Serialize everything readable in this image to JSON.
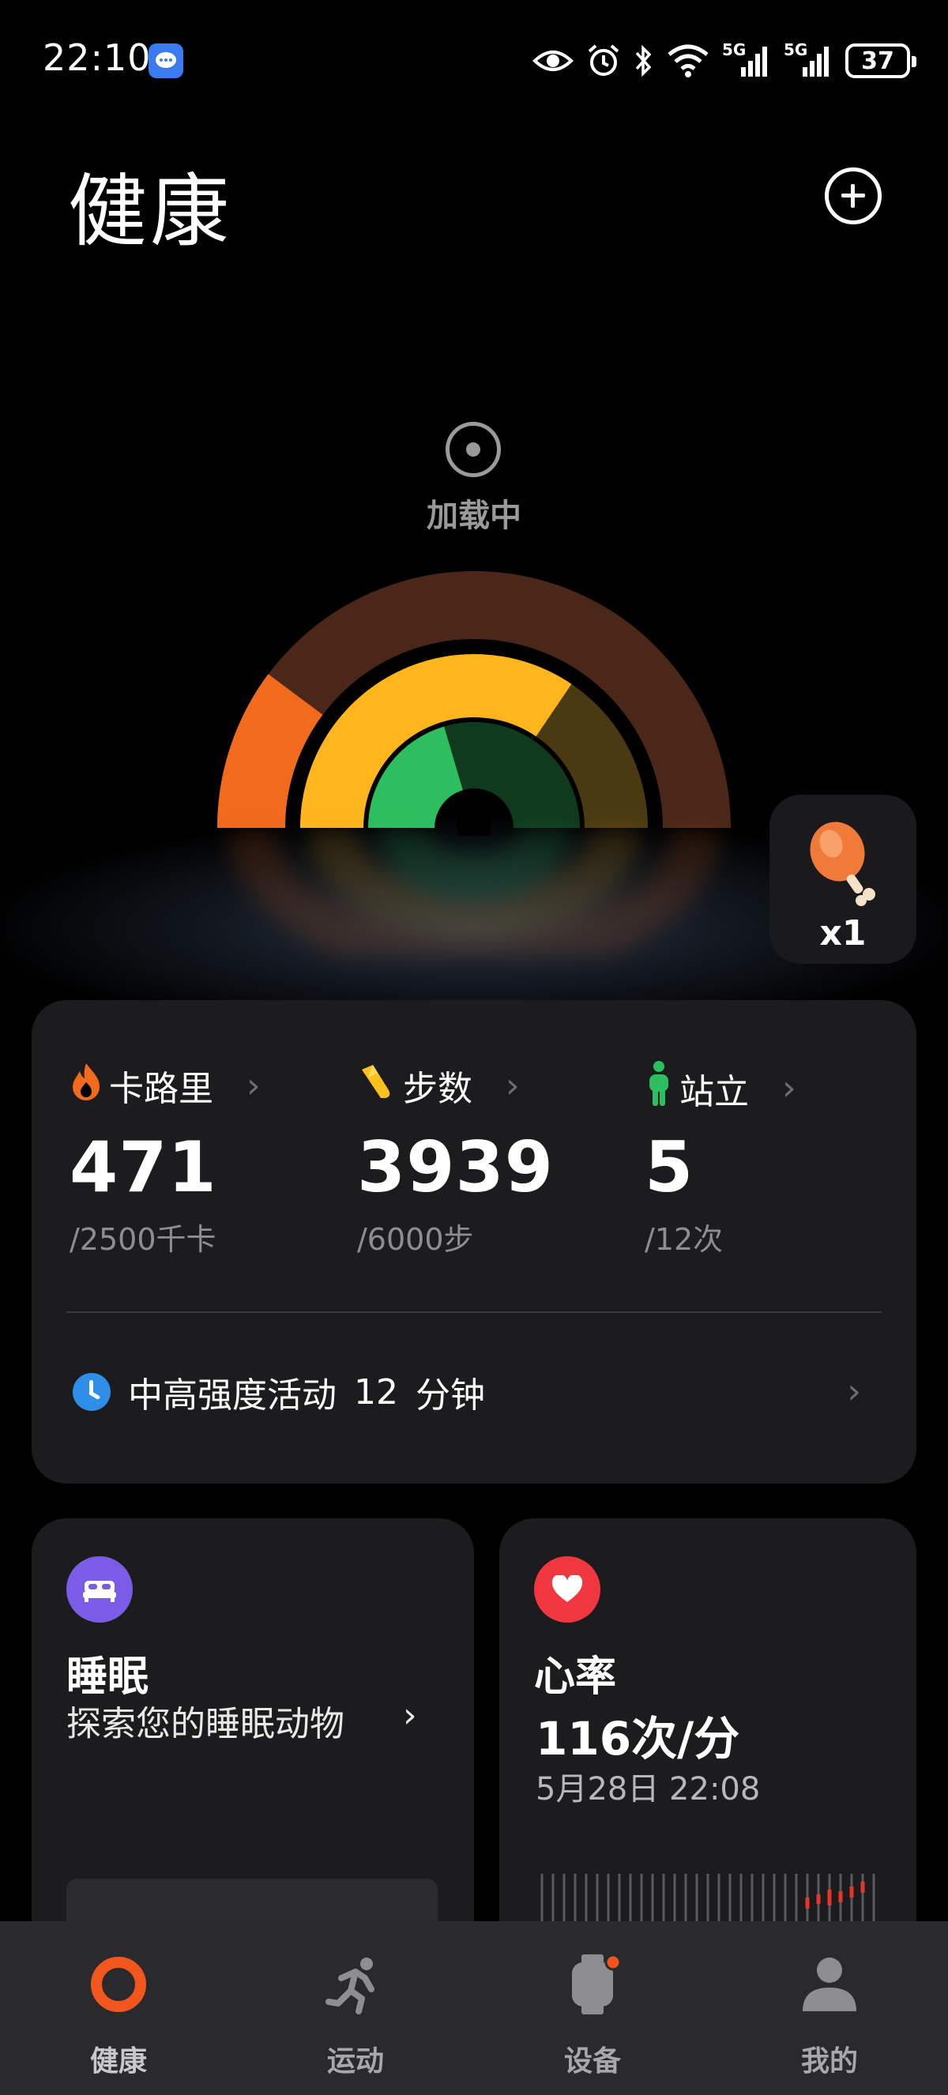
{
  "status_bar": {
    "time": "22:10",
    "network_1": "5G",
    "network_2": "5G",
    "battery": "37"
  },
  "header": {
    "title": "健康"
  },
  "hero": {
    "loading_text": "加载中",
    "reward_count": "x1",
    "colors": {
      "outer_ring": "#f26a1b",
      "middle_ring": "#ffb51c",
      "inner_ring": "#2dbe5f"
    }
  },
  "activity": {
    "metrics": [
      {
        "label": "卡路里",
        "value": "471",
        "goal": "/2500千卡",
        "icon": "flame-icon"
      },
      {
        "label": "步数",
        "value": "3939",
        "goal": "/6000步",
        "icon": "shoe-icon"
      },
      {
        "label": "站立",
        "value": "5",
        "goal": "/12次",
        "icon": "standing-person-icon"
      }
    ],
    "intense_label": "中高强度活动",
    "intense_value": "12",
    "intense_unit": "分钟"
  },
  "sleep": {
    "title": "睡眠",
    "subtitle": "探索您的睡眠动物"
  },
  "heart_rate": {
    "title": "心率",
    "value": "116次/分",
    "timestamp": "5月28日 22:08"
  },
  "bottom_nav": {
    "items": [
      {
        "label": "健康",
        "icon": "health-ring-icon",
        "active": true
      },
      {
        "label": "运动",
        "icon": "running-icon",
        "active": false
      },
      {
        "label": "设备",
        "icon": "watch-icon",
        "active": false
      },
      {
        "label": "我的",
        "icon": "profile-icon",
        "active": false
      }
    ]
  }
}
